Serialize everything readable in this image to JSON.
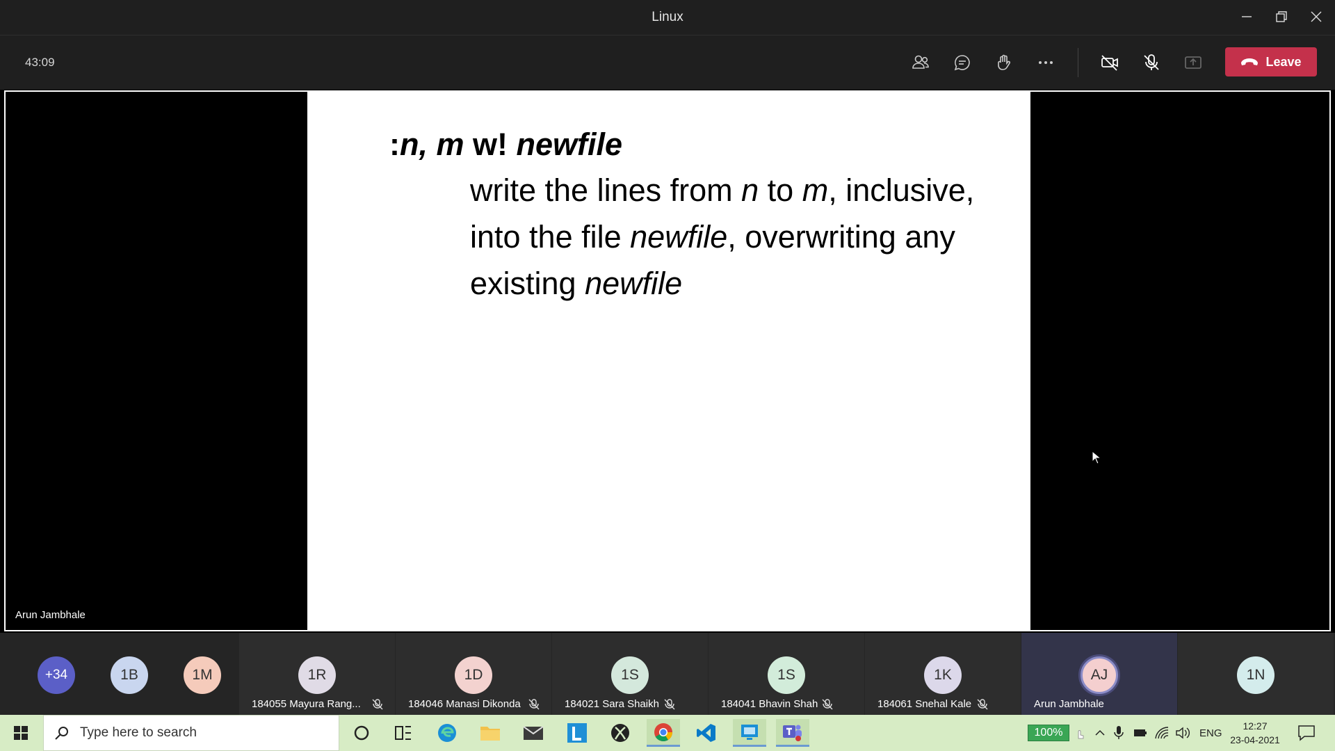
{
  "window": {
    "title": "Linux"
  },
  "toolbar": {
    "timer": "43:09",
    "leave_label": "Leave",
    "icons": [
      "people-icon",
      "chat-icon",
      "raise-hand-icon",
      "more-icon",
      "camera-off-icon",
      "mic-off-icon",
      "share-icon"
    ]
  },
  "slide": {
    "heading_prefix": ":",
    "heading_nm": "n, m",
    "heading_w": " w! ",
    "heading_file": "newfile",
    "line1_a": "write the lines from ",
    "line1_n": "n",
    "line1_b": " to ",
    "line1_m": "m",
    "line1_c": ", inclusive,",
    "line2_a": "into the file ",
    "line2_file": "newfile",
    "line2_b": ", overwriting any",
    "line3_a": "existing ",
    "line3_file": "newfile"
  },
  "presenter": {
    "name": "Arun Jambhale"
  },
  "participants": {
    "overflow": "+34",
    "small": [
      {
        "initials": "1B",
        "color": "#c9d6ef"
      },
      {
        "initials": "1M",
        "color": "#f5cbbb"
      }
    ],
    "tiles": [
      {
        "initials": "1R",
        "name": "184055 Mayura Rang...",
        "color": "#e0dbe6"
      },
      {
        "initials": "1D",
        "name": "184046 Manasi Dikonda",
        "color": "#f3d2cf"
      },
      {
        "initials": "1S",
        "name": "184021 Sara Shaikh",
        "color": "#d4e8dc"
      },
      {
        "initials": "1S",
        "name": "184041 Bhavin Shah",
        "color": "#d2ecda"
      },
      {
        "initials": "1K",
        "name": "184061 Snehal Kale",
        "color": "#dcd8ea"
      },
      {
        "initials": "AJ",
        "name": "Arun Jambhale",
        "color": "#f4cfcf"
      },
      {
        "initials": "1N",
        "name": "",
        "color": "#d4ecec"
      }
    ]
  },
  "taskbar": {
    "search_placeholder": "Type here to search",
    "battery": "100%",
    "language": "ENG",
    "time": "12:27",
    "date": "23-04-2021"
  }
}
